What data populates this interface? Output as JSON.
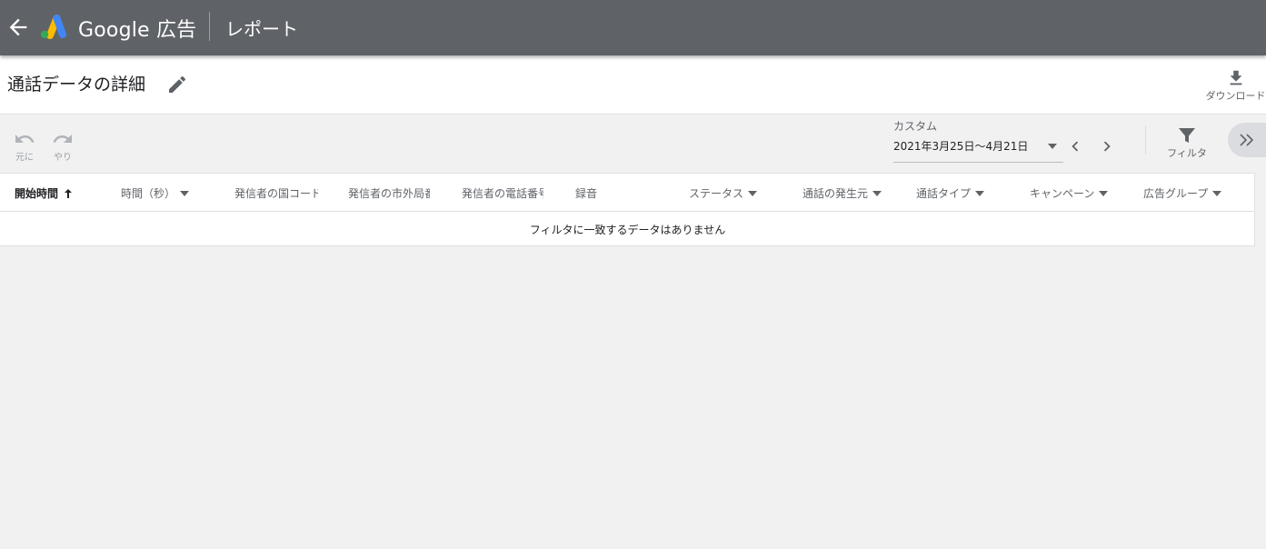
{
  "app": {
    "product_name": "Google 広告",
    "section": "レポート",
    "back_icon": "arrow-back-icon",
    "logo_icon": "google-ads-logo",
    "brand_colors": {
      "appbar": "#5f6368",
      "logo_blue": "#4285f4",
      "logo_yellow": "#fbbc04",
      "logo_green": "#34a853"
    }
  },
  "titlebar": {
    "title": "通話データの詳細",
    "edit_icon": "pencil-icon",
    "download_label": "ダウンロード",
    "download_icon": "download-icon"
  },
  "toolbar": {
    "undo_label": "元に",
    "undo_icon": "undo-icon",
    "redo_label": "やり",
    "redo_icon": "redo-icon",
    "date_range_label": "カスタム",
    "date_range_value": "2021年3月25日～4月21日",
    "prev_icon": "chevron-left-icon",
    "next_icon": "chevron-right-icon",
    "filter_label": "フィルタ",
    "filter_icon": "filter-icon",
    "expand_icon": "double-chevron-right-icon"
  },
  "table": {
    "columns": [
      {
        "label": "開始時間",
        "sort": "ascending"
      },
      {
        "label": "時間（秒）",
        "dropdown": true
      },
      {
        "label": "発信者の国コード",
        "dropdown": false
      },
      {
        "label": "発信者の市外局番",
        "dropdown": false
      },
      {
        "label": "発信者の電話番号",
        "dropdown": false
      },
      {
        "label": "録音",
        "dropdown": false
      },
      {
        "label": "ステータス",
        "dropdown": true
      },
      {
        "label": "通話の発生元",
        "dropdown": true
      },
      {
        "label": "通話タイプ",
        "dropdown": true
      },
      {
        "label": "キャンペーン",
        "dropdown": true
      },
      {
        "label": "広告グループ",
        "dropdown": true
      }
    ],
    "empty_message": "フィルタに一致するデータはありません"
  }
}
